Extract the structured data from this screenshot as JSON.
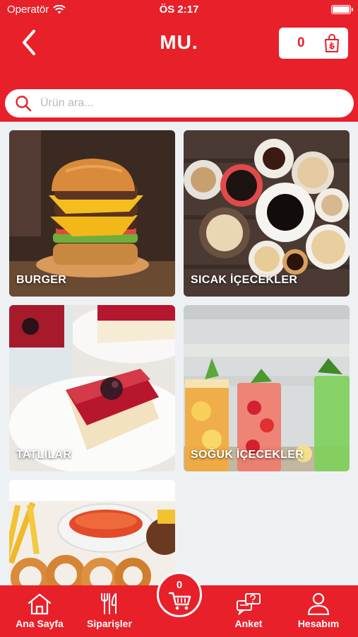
{
  "status_bar": {
    "carrier": "Operatör",
    "time": "ÖS 2:17"
  },
  "header": {
    "title": "MU.",
    "cart_count": "0"
  },
  "search": {
    "placeholder": "Ürün ara..."
  },
  "categories": [
    {
      "label": "BURGER"
    },
    {
      "label": "SICAK İÇECEKLER"
    },
    {
      "label": "TATLILAR"
    },
    {
      "label": "SOĞUK İÇECEKLER"
    },
    {
      "label": ""
    }
  ],
  "cart_fab": {
    "count": "0"
  },
  "bottom_nav": [
    {
      "label": "Ana Sayfa",
      "icon": "home-icon"
    },
    {
      "label": "Siparişler",
      "icon": "fork-knife-icon"
    },
    {
      "label": "Anket",
      "icon": "survey-chat-icon"
    },
    {
      "label": "Hesabım",
      "icon": "user-icon"
    }
  ],
  "colors": {
    "brand_red": "#e8202a",
    "background": "#eef1f4"
  }
}
